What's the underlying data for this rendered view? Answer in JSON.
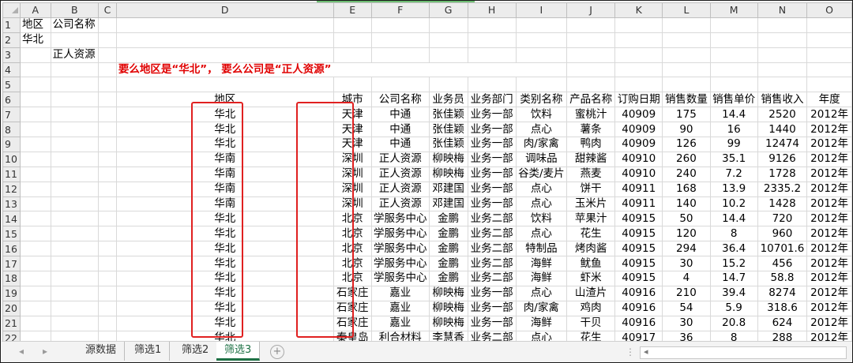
{
  "columns": [
    "A",
    "B",
    "C",
    "D",
    "E",
    "F",
    "G",
    "H",
    "I",
    "J",
    "K",
    "L",
    "M",
    "N",
    "O"
  ],
  "rows": [
    [
      "地区",
      "公司名称",
      "",
      "",
      "",
      "",
      "",
      "",
      "",
      "",
      "",
      "",
      "",
      "",
      ""
    ],
    [
      "华北",
      "",
      "",
      "",
      "",
      "",
      "",
      "",
      "",
      "",
      "",
      "",
      "",
      "",
      ""
    ],
    [
      "",
      "正人资源",
      "",
      "",
      "",
      "",
      "",
      "",
      "",
      "",
      "",
      "",
      "",
      "",
      ""
    ],
    [
      "",
      "",
      "",
      "要么地区是“华北”， 要么公司是“正人资源”",
      "",
      "",
      "",
      "",
      "",
      "",
      "",
      "",
      "",
      "",
      ""
    ],
    [
      "",
      "",
      "",
      "",
      "",
      "",
      "",
      "",
      "",
      "",
      "",
      "",
      "",
      "",
      ""
    ],
    [
      "",
      "",
      "",
      "地区",
      "城市",
      "公司名称",
      "业务员",
      "业务部门",
      "类别名称",
      "产品名称",
      "订购日期",
      "销售数量",
      "销售单价",
      "销售收入",
      "年度"
    ],
    [
      "",
      "",
      "",
      "华北",
      "天津",
      "中通",
      "张佳颖",
      "业务一部",
      "饮料",
      "蜜桃汁",
      "40909",
      "175",
      "14.4",
      "2520",
      "2012年"
    ],
    [
      "",
      "",
      "",
      "华北",
      "天津",
      "中通",
      "张佳颖",
      "业务一部",
      "点心",
      "薯条",
      "40909",
      "90",
      "16",
      "1440",
      "2012年"
    ],
    [
      "",
      "",
      "",
      "华北",
      "天津",
      "中通",
      "张佳颖",
      "业务一部",
      "肉/家禽",
      "鸭肉",
      "40909",
      "126",
      "99",
      "12474",
      "2012年"
    ],
    [
      "",
      "",
      "",
      "华南",
      "深圳",
      "正人资源",
      "柳映梅",
      "业务一部",
      "调味品",
      "甜辣酱",
      "40910",
      "260",
      "35.1",
      "9126",
      "2012年"
    ],
    [
      "",
      "",
      "",
      "华南",
      "深圳",
      "正人资源",
      "柳映梅",
      "业务一部",
      "谷类/麦片",
      "燕麦",
      "40910",
      "240",
      "7.2",
      "1728",
      "2012年"
    ],
    [
      "",
      "",
      "",
      "华南",
      "深圳",
      "正人资源",
      "邓建国",
      "业务一部",
      "点心",
      "饼干",
      "40911",
      "168",
      "13.9",
      "2335.2",
      "2012年"
    ],
    [
      "",
      "",
      "",
      "华南",
      "深圳",
      "正人资源",
      "邓建国",
      "业务一部",
      "点心",
      "玉米片",
      "40911",
      "140",
      "10.2",
      "1428",
      "2012年"
    ],
    [
      "",
      "",
      "",
      "华北",
      "北京",
      "学服务中心",
      "金鹏",
      "业务二部",
      "饮料",
      "苹果汁",
      "40915",
      "50",
      "14.4",
      "720",
      "2012年"
    ],
    [
      "",
      "",
      "",
      "华北",
      "北京",
      "学服务中心",
      "金鹏",
      "业务二部",
      "点心",
      "花生",
      "40915",
      "120",
      "8",
      "960",
      "2012年"
    ],
    [
      "",
      "",
      "",
      "华北",
      "北京",
      "学服务中心",
      "金鹏",
      "业务二部",
      "特制品",
      "烤肉酱",
      "40915",
      "294",
      "36.4",
      "10701.6",
      "2012年"
    ],
    [
      "",
      "",
      "",
      "华北",
      "北京",
      "学服务中心",
      "金鹏",
      "业务二部",
      "海鲜",
      "鱿鱼",
      "40915",
      "30",
      "15.2",
      "456",
      "2012年"
    ],
    [
      "",
      "",
      "",
      "华北",
      "北京",
      "学服务中心",
      "金鹏",
      "业务二部",
      "海鲜",
      "虾米",
      "40915",
      "4",
      "14.7",
      "58.8",
      "2012年"
    ],
    [
      "",
      "",
      "",
      "华北",
      "石家庄",
      "嘉业",
      "柳映梅",
      "业务一部",
      "点心",
      "山渣片",
      "40916",
      "210",
      "39.4",
      "8274",
      "2012年"
    ],
    [
      "",
      "",
      "",
      "华北",
      "石家庄",
      "嘉业",
      "柳映梅",
      "业务一部",
      "肉/家禽",
      "鸡肉",
      "40916",
      "54",
      "5.9",
      "318.6",
      "2012年"
    ],
    [
      "",
      "",
      "",
      "华北",
      "石家庄",
      "嘉业",
      "柳映梅",
      "业务一部",
      "海鲜",
      "干贝",
      "40916",
      "30",
      "20.8",
      "624",
      "2012年"
    ],
    [
      "",
      "",
      "",
      "华北",
      "秦皇岛",
      "利合材料",
      "李慧香",
      "业务二部",
      "点心",
      "花生",
      "40917",
      "36",
      "8",
      "288",
      "2012年"
    ]
  ],
  "tabs": [
    "源数据",
    "筛选1",
    "筛选2",
    "筛选3"
  ],
  "active_tab": "筛选3",
  "tab_nav": {
    "prev": "◂",
    "next": "▸",
    "add": "+"
  },
  "colors": {
    "accent": "#1e7145",
    "highlight": "#e02020",
    "note": "#e00000",
    "header_bg": "#ececec"
  }
}
